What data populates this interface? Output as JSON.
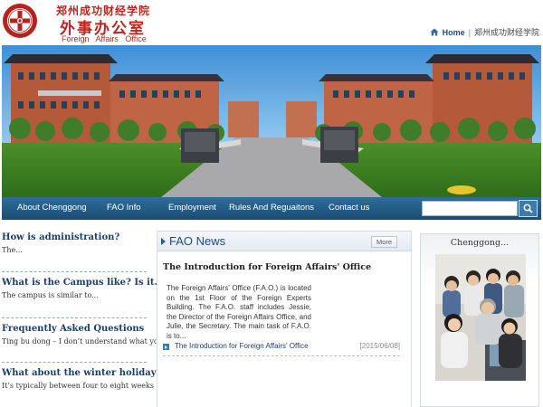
{
  "header": {
    "title_cn_top": "郑州成功财经学院",
    "title_cn_main": "外事办公室",
    "title_en": "Foreign Affairs Office",
    "home_label": "Home",
    "separator": "|",
    "school_link": "郑州成功财经学院",
    "icons": {
      "logo": "school-seal",
      "home": "house-icon"
    }
  },
  "nav": {
    "items": [
      {
        "label": "About Chenggong"
      },
      {
        "label": "FAO Info"
      },
      {
        "label": "Employment"
      },
      {
        "label": "Rules And Reguaitons"
      },
      {
        "label": "Contact us"
      }
    ],
    "search": {
      "value": "",
      "placeholder": "",
      "icon": "search-icon"
    }
  },
  "sidebar": {
    "items": [
      {
        "title": "How is administration?",
        "desc": "The..."
      },
      {
        "title": "What is the Campus like? Is it...",
        "desc": "The campus is similar to..."
      },
      {
        "title": "Frequently Asked Questions",
        "desc": "Ting bu dong – I don’t understand what you..."
      },
      {
        "title": "What about the winter holiday?",
        "desc": "It’s typically between four to eight weeks ..."
      }
    ]
  },
  "fao": {
    "title": "FAO News",
    "more_label": "More",
    "article_title": "The Introduction for Foreign Affairs' Office",
    "article_body": "The Foreign Affairs' Office (F.A.O.) is located on the 1st Floor of the Foreign Experts Building. The F.A.O. staff includes Jessie, the Director of the Foreign Affairs Office, and Julie, the Secretary. The main task of F.A.O. is to...",
    "news": [
      {
        "title": "The Introduction for Foreign Affairs' Office",
        "date": "[2015/06/08]"
      }
    ]
  },
  "right_panel": {
    "title": "Chenggong..."
  },
  "colors": {
    "brand_red": "#c0241f",
    "nav_blue": "#1a4c72",
    "link_navy": "#1b3f66"
  }
}
